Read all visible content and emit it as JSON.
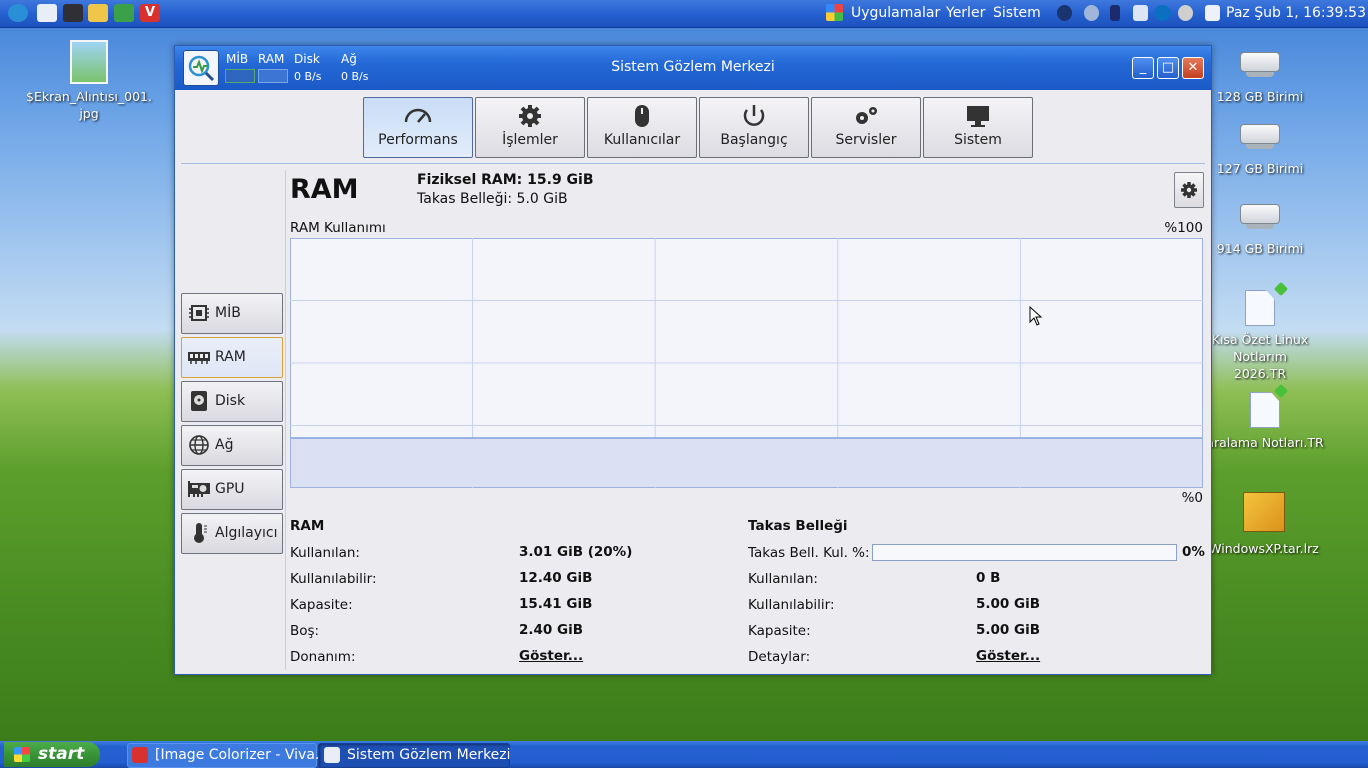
{
  "top_panel": {
    "menu_apps": "Uygulamalar",
    "menu_places": "Yerler",
    "menu_system": "Sistem",
    "clock": "Paz Şub  1, 16:39:53"
  },
  "desktop": {
    "file_name": "$Ekran_Alıntısı_001.\njpg",
    "drive1": "128 GB Birimi",
    "drive2": "127 GB Birimi",
    "drive3": "914 GB Birimi",
    "note1": "Kısa Özet Linux\nNotlarım 2026.TR",
    "note2": "aralama Notları.TR",
    "archive": "WindowsXP.tar.lrz"
  },
  "window": {
    "title": "Sistem Gözlem Merkezi",
    "mini": {
      "cpu_label": "MİB",
      "ram_label": "RAM",
      "disk_label": "Disk",
      "disk_value": "0 B/s",
      "net_label": "Ağ",
      "net_value": "0 B/s"
    }
  },
  "tabs": [
    {
      "label": "Performans",
      "icon": "gauge-icon",
      "active": true
    },
    {
      "label": "İşlemler",
      "icon": "cog-icon"
    },
    {
      "label": "Kullanıcılar",
      "icon": "mouse-icon"
    },
    {
      "label": "Başlangıç",
      "icon": "power-icon"
    },
    {
      "label": "Servisler",
      "icon": "gears-icon"
    },
    {
      "label": "Sistem",
      "icon": "monitor-icon"
    }
  ],
  "side_buttons": [
    {
      "label": "MİB",
      "icon": "cpu-icon"
    },
    {
      "label": "RAM",
      "icon": "ram-icon",
      "active": true
    },
    {
      "label": "Disk",
      "icon": "disk-icon"
    },
    {
      "label": "Ağ",
      "icon": "globe-icon"
    },
    {
      "label": "GPU",
      "icon": "gpu-icon"
    },
    {
      "label": "Algılayıcı",
      "icon": "thermometer-icon"
    }
  ],
  "ram_panel": {
    "title": "RAM",
    "physical_ram": "Fiziksel RAM: 15.9 GiB",
    "swap_size": "Takas Belleği: 5.0 GiB",
    "graph_label": "RAM Kullanımı",
    "pct_top": "%100",
    "pct_bottom": "%0",
    "usage_percent": 20
  },
  "ram_stats": {
    "heading": "RAM",
    "used_label": "Kullanılan:",
    "used_value": "3.01 GiB (20%)",
    "avail_label": "Kullanılabilir:",
    "avail_value": "12.40 GiB",
    "cap_label": "Kapasite:",
    "cap_value": "15.41 GiB",
    "free_label": "Boş:",
    "free_value": "2.40 GiB",
    "hw_label": "Donanım:",
    "hw_link": "Göster..."
  },
  "swap_stats": {
    "heading": "Takas Belleği",
    "usage_label": "Takas Bell. Kul. %:",
    "usage_value": "0%",
    "usage_fraction": 0,
    "used_label": "Kullanılan:",
    "used_value": "0 B",
    "avail_label": "Kullanılabilir:",
    "avail_value": "5.00 GiB",
    "cap_label": "Kapasite:",
    "cap_value": "5.00 GiB",
    "details_label": "Detaylar:",
    "details_link": "Göster..."
  },
  "taskbar": {
    "start": "start",
    "task1": "[Image Colorizer - Viva...",
    "task2": "Sistem Gözlem Merkezi"
  }
}
